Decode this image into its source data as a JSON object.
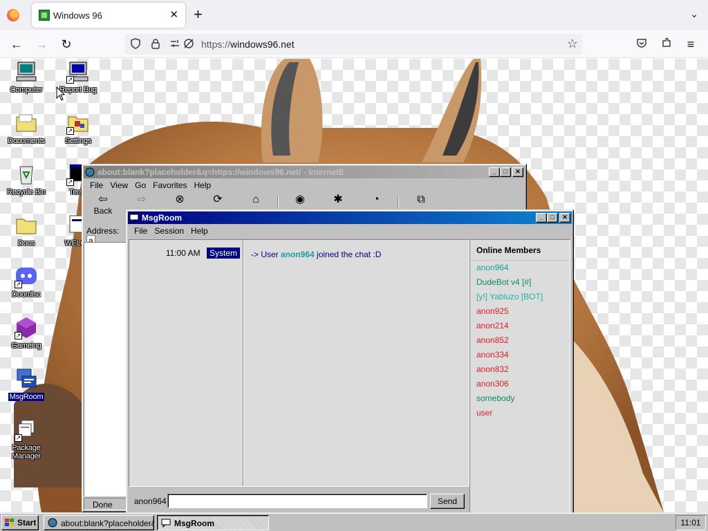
{
  "browser": {
    "tab_title": "Windows 96",
    "close_glyph": "✕",
    "newtab_glyph": "+",
    "listall_glyph": "⌄",
    "url_scheme": "https://",
    "url_host": "windows96.net"
  },
  "desktop_icons": [
    {
      "label": "Computer"
    },
    {
      "label": "Report Bug"
    },
    {
      "label": "Documents"
    },
    {
      "label": "Settings"
    },
    {
      "label": "Recycle Bin"
    },
    {
      "label": "Termi"
    },
    {
      "label": "Docs"
    },
    {
      "label": "WELCO"
    },
    {
      "label": "Doordisc"
    },
    {
      "label": "Gameing"
    },
    {
      "label": "MsgRoom"
    },
    {
      "label": "Package Manager"
    }
  ],
  "ie_window": {
    "title": "about:blank?placeholder&q=https://windows96.net/ - InternetE",
    "menu": [
      "File",
      "View",
      "Go",
      "Favorites",
      "Help"
    ],
    "back_label": "Back",
    "address_label": "Address:",
    "address_value": "a",
    "status": "Done"
  },
  "msgroom": {
    "title": "MsgRoom",
    "menu": [
      "File",
      "Session",
      "Help"
    ],
    "message": {
      "time": "11:00 AM",
      "sender": "System",
      "prefix": "-> User ",
      "user": "anon964",
      "suffix": " joined the chat :D"
    },
    "members_title": "Online Members",
    "members": [
      {
        "name": "anon964",
        "color": "#1aa0a0"
      },
      {
        "name": "DudeBot v4 [#]",
        "color": "#0a8a6a"
      },
      {
        "name": "[y!] Yabluzo [BOT]",
        "color": "#20b0a0"
      },
      {
        "name": "anon925",
        "color": "#e02020"
      },
      {
        "name": "anon214",
        "color": "#e02020"
      },
      {
        "name": "anon852",
        "color": "#e02020"
      },
      {
        "name": "anon334",
        "color": "#e02020"
      },
      {
        "name": "anon832",
        "color": "#e02020"
      },
      {
        "name": "anon306",
        "color": "#e02020"
      },
      {
        "name": "somebody",
        "color": "#0a8a6a"
      },
      {
        "name": "user",
        "color": "#e02020"
      }
    ],
    "username": "anon964",
    "send_label": "Send"
  },
  "taskbar": {
    "start": "Start",
    "tasks": [
      "about:blank?placeholder&...",
      "MsgRoom"
    ],
    "clock": "11:01"
  },
  "colors": {
    "title_active": "#000080",
    "title_inactive": "#808080",
    "face": "#c0c0c0"
  }
}
